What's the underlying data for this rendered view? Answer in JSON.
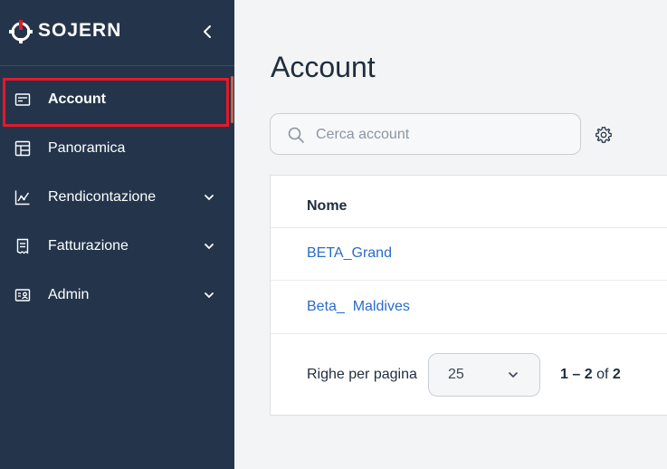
{
  "sidebar": {
    "brand": "SOJERN",
    "items": [
      {
        "label": "Account",
        "icon": "account-card-icon",
        "active": true,
        "expandable": false
      },
      {
        "label": "Panoramica",
        "icon": "calendar-dashboard-icon",
        "active": false,
        "expandable": false
      },
      {
        "label": "Rendicontazione",
        "icon": "chart-line-icon",
        "active": false,
        "expandable": true
      },
      {
        "label": "Fatturazione",
        "icon": "receipt-icon",
        "active": false,
        "expandable": true
      },
      {
        "label": "Admin",
        "icon": "id-card-icon",
        "active": false,
        "expandable": true
      }
    ]
  },
  "main": {
    "title": "Account",
    "search": {
      "placeholder": "Cerca account",
      "value": ""
    },
    "table": {
      "columns": [
        "Nome"
      ],
      "rows": [
        {
          "name": "BETA_Grand"
        },
        {
          "name": "Beta_  Maldives"
        }
      ]
    },
    "pagination": {
      "rows_label": "Righe per pagina",
      "page_size": "25",
      "range_start": "1",
      "range_end": "2",
      "of_label": "of",
      "total": "2"
    }
  },
  "colors": {
    "sidebar_bg": "#24354b",
    "accent_red": "#e3192b",
    "link_blue": "#2a6bcc",
    "page_bg": "#f2f4f5"
  }
}
